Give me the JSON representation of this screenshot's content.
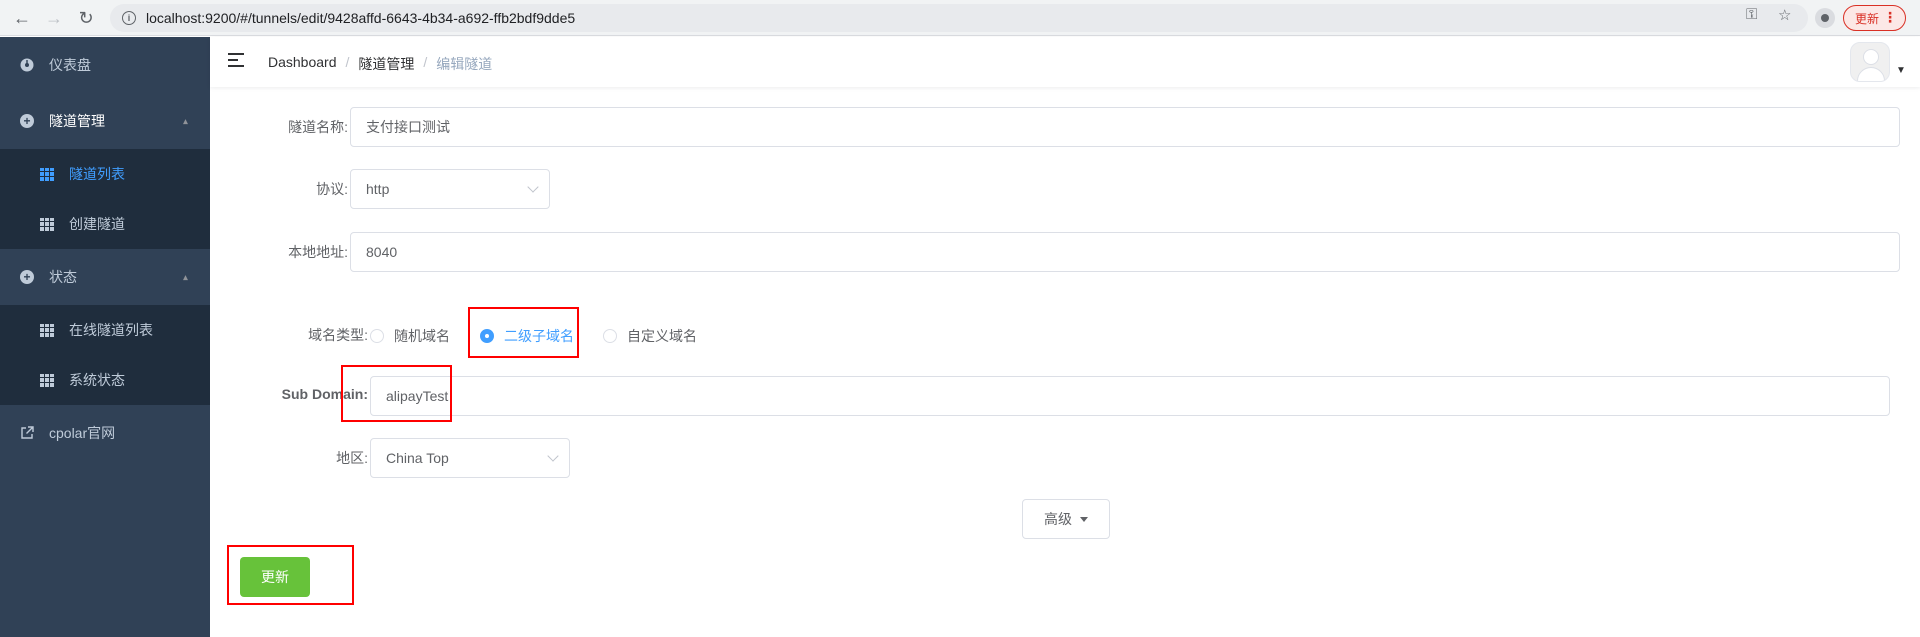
{
  "browser": {
    "url": "localhost:9200/#/tunnels/edit/9428affd-6643-4b34-a692-ffb2bdf9dde5",
    "update_label": "更新",
    "menu_dots": "⋮"
  },
  "sidebar": {
    "items": [
      {
        "label": "仪表盘",
        "icon": "dashboard-icon"
      },
      {
        "label": "隧道管理",
        "icon": "plus-circle-icon",
        "expanded": true,
        "children": [
          {
            "label": "隧道列表",
            "icon": "grid-icon",
            "active": true
          },
          {
            "label": "创建隧道",
            "icon": "grid-icon"
          }
        ]
      },
      {
        "label": "状态",
        "icon": "plus-circle-icon",
        "expanded": true,
        "children": [
          {
            "label": "在线隧道列表",
            "icon": "grid-icon"
          },
          {
            "label": "系统状态",
            "icon": "grid-icon"
          }
        ]
      },
      {
        "label": "cpolar官网",
        "icon": "external-link-icon"
      }
    ]
  },
  "header": {
    "breadcrumb": [
      "Dashboard",
      "隧道管理",
      "编辑隧道"
    ],
    "separator": "/"
  },
  "form": {
    "name_label": "隧道名称:",
    "name_value": "支付接口测试",
    "protocol_label": "协议:",
    "protocol_value": "http",
    "local_label": "本地地址:",
    "local_value": "8040",
    "domain_type_label": "域名类型:",
    "domain_types": [
      {
        "label": "随机域名",
        "checked": false
      },
      {
        "label": "二级子域名",
        "checked": true
      },
      {
        "label": "自定义域名",
        "checked": false
      }
    ],
    "subdomain_label": "Sub Domain:",
    "subdomain_value": "alipayTest",
    "region_label": "地区:",
    "region_value": "China Top",
    "advanced_label": "高级",
    "submit_label": "更新"
  },
  "colors": {
    "sidebar_bg": "#304156",
    "submenu_bg": "#1f2d3d",
    "accent": "#409eff",
    "success": "#67c23a",
    "highlight": "#ff0000"
  }
}
